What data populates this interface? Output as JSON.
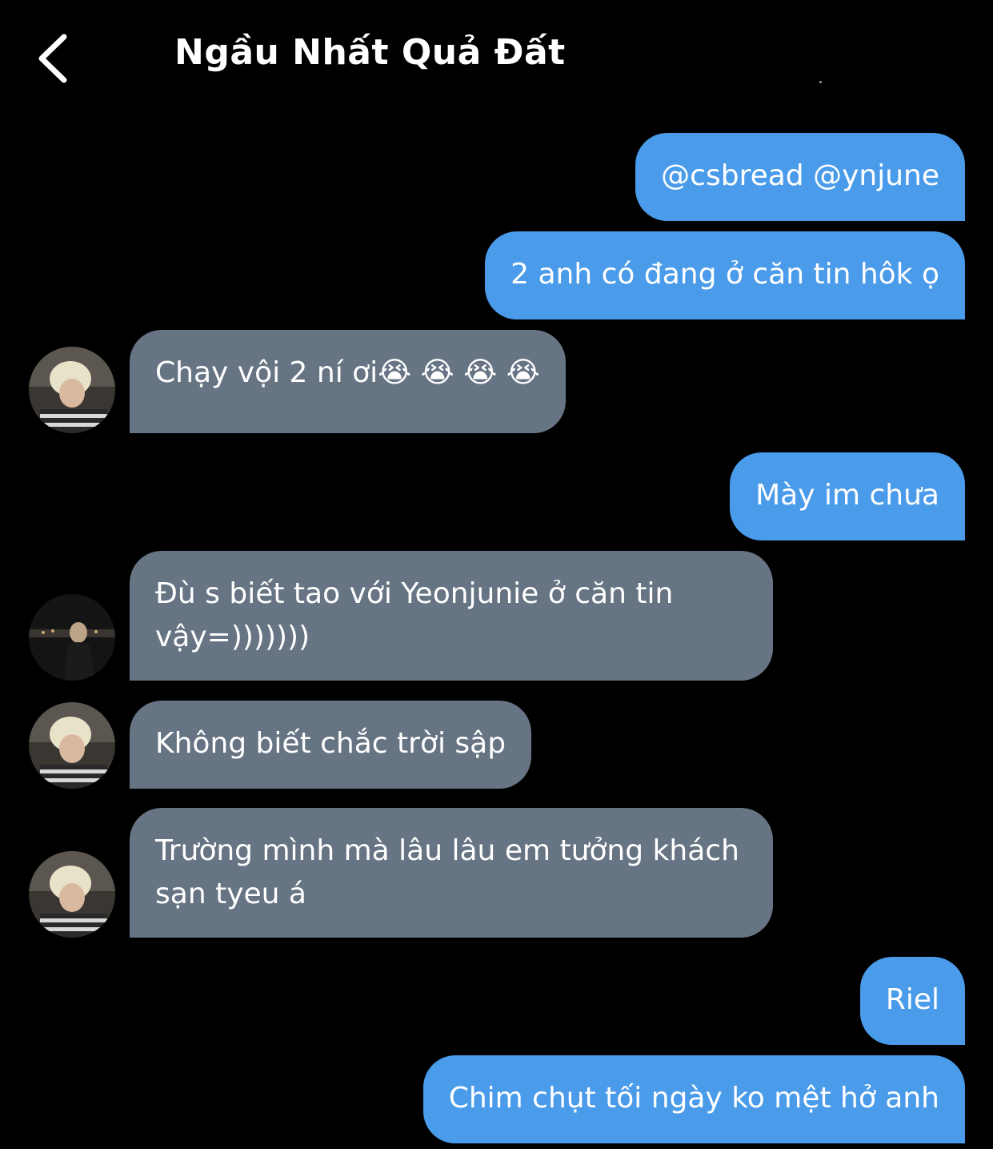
{
  "header": {
    "title": "Ngầu Nhất Quả Đất",
    "back_icon": "chevron-left-icon"
  },
  "colors": {
    "background": "#000000",
    "outgoing_bubble": "#4a9bea",
    "incoming_bubble": "#667483",
    "text": "#ffffff"
  },
  "messages": [
    {
      "direction": "outgoing",
      "text": "@csbread @ynjune"
    },
    {
      "direction": "outgoing",
      "text": "2 anh có đang ở căn tin hôk ọ"
    },
    {
      "direction": "incoming",
      "avatar": "blonde-avatar",
      "text": "Chạy vội 2 ní ơi😭 😭 😭 😭"
    },
    {
      "direction": "outgoing",
      "text": "Mày im chưa"
    },
    {
      "direction": "incoming",
      "avatar": "dark-avatar",
      "text": "Đù s biết tao với Yeonjunie ở căn tin vậy=)))))))"
    },
    {
      "direction": "incoming",
      "avatar": "blonde-avatar",
      "text": "Không biết chắc trời sập"
    },
    {
      "direction": "incoming",
      "avatar": "blonde-avatar",
      "text": "Trường mình mà lâu lâu em tưởng khách sạn tyeu á"
    },
    {
      "direction": "outgoing",
      "text": "Riel"
    },
    {
      "direction": "outgoing",
      "text": "Chim chụt tối ngày ko mệt hở anh"
    }
  ]
}
